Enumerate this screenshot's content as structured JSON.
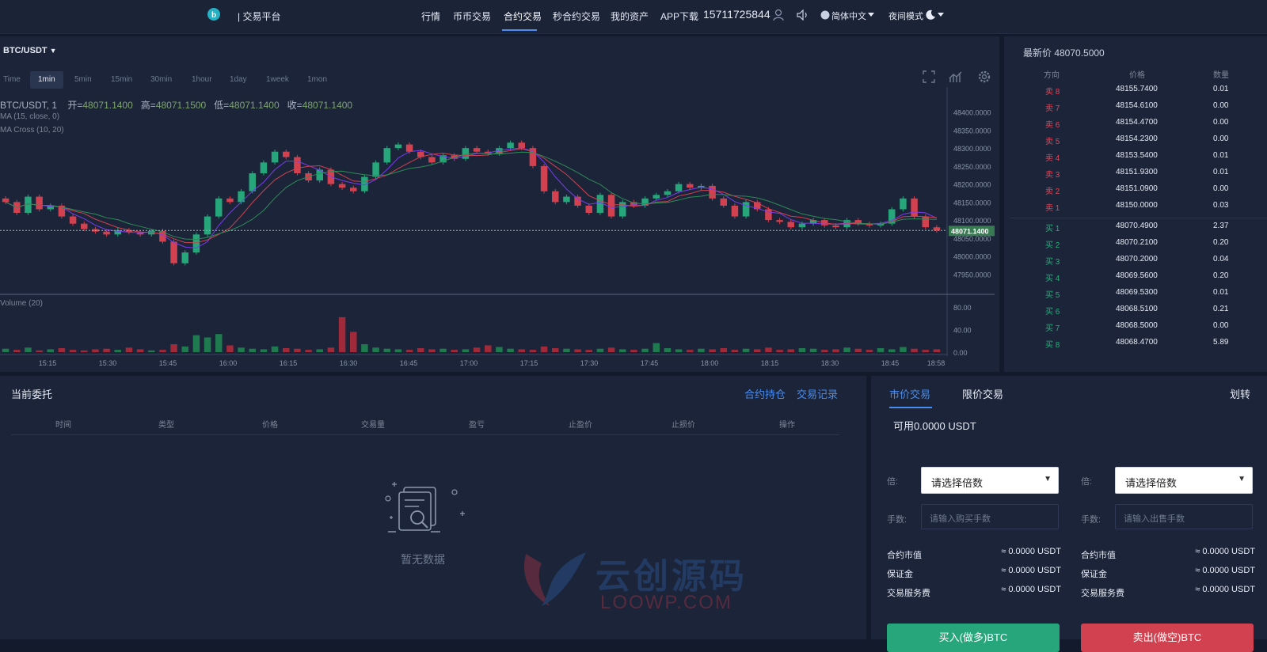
{
  "header": {
    "brand": "| 交易平台",
    "nav": [
      "行情",
      "币币交易",
      "合约交易",
      "秒合约交易",
      "我的资产",
      "APP下载"
    ],
    "active_nav": "合约交易",
    "phone": "15711725844",
    "language": "简体中文",
    "night_mode": "夜间模式"
  },
  "chart": {
    "pair": "BTC/USDT",
    "timeframes": [
      "Time",
      "1min",
      "5min",
      "15min",
      "30min",
      "1hour",
      "1day",
      "1week",
      "1mon"
    ],
    "active_timeframe": "1min",
    "symbol_line": "BTC/USDT, 1",
    "open_label": "开=",
    "open": "48071.1400",
    "high_label": "高=",
    "high": "48071.1500",
    "low_label": "低=",
    "low": "48071.1400",
    "close_label": "收=",
    "close": "48071.1400",
    "indicator_ma": "MA (15, close, 0)",
    "indicator_cross": "MA Cross (10, 20)",
    "indicator_volume": "Volume (20)",
    "last_price_label": "48071.1400"
  },
  "chart_data": {
    "type": "candlestick",
    "y_ticks": [
      "48400.0000",
      "48350.0000",
      "48300.0000",
      "48250.0000",
      "48200.0000",
      "48150.0000",
      "48100.0000",
      "48050.0000",
      "48000.0000",
      "47950.0000"
    ],
    "ylim": [
      47920,
      48430
    ],
    "x_ticks": [
      "15:15",
      "15:30",
      "15:45",
      "16:00",
      "16:15",
      "16:30",
      "16:45",
      "17:00",
      "17:15",
      "17:30",
      "17:45",
      "18:00",
      "18:15",
      "18:30",
      "18:45",
      "18:58"
    ],
    "volume_ticks": [
      "80.00",
      "40.00",
      "0.00"
    ],
    "volume_ylim": [
      0,
      80
    ],
    "close_path": [
      48150,
      48120,
      48165,
      48130,
      48140,
      48110,
      48090,
      48075,
      48068,
      48060,
      48072,
      48066,
      48060,
      48070,
      48040,
      47980,
      48010,
      48060,
      48110,
      48160,
      48150,
      48180,
      48230,
      48260,
      48290,
      48275,
      48230,
      48210,
      48240,
      48200,
      48190,
      48180,
      48220,
      48260,
      48300,
      48310,
      48290,
      48275,
      48260,
      48280,
      48270,
      48300,
      48290,
      48285,
      48300,
      48315,
      48300,
      48250,
      48180,
      48150,
      48165,
      48140,
      48120,
      48170,
      48110,
      48150,
      48140,
      48160,
      48170,
      48180,
      48200,
      48190,
      48195,
      48160,
      48140,
      48110,
      48150,
      48130,
      48100,
      48095,
      48080,
      48090,
      48100,
      48085,
      48080,
      48100,
      48090,
      48085,
      48090,
      48130,
      48160,
      48110,
      48080,
      48071
    ],
    "volumes": [
      6,
      4,
      8,
      3,
      5,
      7,
      4,
      3,
      5,
      6,
      4,
      8,
      5,
      3,
      4,
      14,
      10,
      30,
      26,
      32,
      12,
      8,
      6,
      5,
      10,
      7,
      6,
      4,
      5,
      8,
      62,
      36,
      14,
      8,
      6,
      5,
      4,
      7,
      5,
      6,
      4,
      5,
      8,
      12,
      9,
      6,
      5,
      4,
      10,
      7,
      6,
      5,
      4,
      6,
      8,
      5,
      4,
      6,
      16,
      7,
      5,
      4,
      6,
      5,
      7,
      4,
      6,
      5,
      8,
      4,
      5,
      7,
      6,
      4,
      5,
      8,
      6,
      4,
      7,
      5,
      9,
      6,
      4,
      5
    ]
  },
  "orderbook": {
    "title": "最新价 48070.5000",
    "headers": [
      "方向",
      "价格",
      "数量"
    ],
    "asks": [
      {
        "side": "卖 8",
        "price": "48155.7400",
        "qty": "0.01"
      },
      {
        "side": "卖 7",
        "price": "48154.6100",
        "qty": "0.00"
      },
      {
        "side": "卖 6",
        "price": "48154.4700",
        "qty": "0.00"
      },
      {
        "side": "卖 5",
        "price": "48154.2300",
        "qty": "0.00"
      },
      {
        "side": "卖 4",
        "price": "48153.5400",
        "qty": "0.01"
      },
      {
        "side": "卖 3",
        "price": "48151.9300",
        "qty": "0.01"
      },
      {
        "side": "卖 2",
        "price": "48151.0900",
        "qty": "0.00"
      },
      {
        "side": "卖 1",
        "price": "48150.0000",
        "qty": "0.03"
      }
    ],
    "bids": [
      {
        "side": "买 1",
        "price": "48070.4900",
        "qty": "2.37"
      },
      {
        "side": "买 2",
        "price": "48070.2100",
        "qty": "0.20"
      },
      {
        "side": "买 3",
        "price": "48070.2000",
        "qty": "0.04"
      },
      {
        "side": "买 4",
        "price": "48069.5600",
        "qty": "0.20"
      },
      {
        "side": "买 5",
        "price": "48069.5300",
        "qty": "0.01"
      },
      {
        "side": "买 6",
        "price": "48068.5100",
        "qty": "0.21"
      },
      {
        "side": "买 7",
        "price": "48068.5000",
        "qty": "0.00"
      },
      {
        "side": "买 8",
        "price": "48068.4700",
        "qty": "5.89"
      }
    ]
  },
  "orders": {
    "title": "当前委托",
    "links": [
      "合约持仓",
      "交易记录"
    ],
    "columns": [
      "时间",
      "类型",
      "价格",
      "交易量",
      "盈亏",
      "止盈价",
      "止损价",
      "操作"
    ],
    "empty": "暂无数据"
  },
  "trade": {
    "tabs": [
      "市价交易",
      "限价交易"
    ],
    "transfer": "划转",
    "available": "可用0.0000 USDT",
    "leverage_label": "倍:",
    "leverage_placeholder": "请选择倍数",
    "qty_label": "手数:",
    "buy_qty_placeholder": "请输入购买手数",
    "sell_qty_placeholder": "请输入出售手数",
    "contract_value_label": "合约市值",
    "margin_label": "保证金",
    "fee_label": "交易服务费",
    "zero_value": "≈ 0.0000 USDT",
    "buy_button": "买入(做多)BTC",
    "sell_button": "卖出(做空)BTC"
  },
  "watermark": {
    "cn": "云创源码",
    "en": "LOOWP.COM"
  },
  "colors": {
    "up": "#26a67a",
    "down": "#d2414f",
    "accent": "#4a8df0",
    "bg_panel": "#1b2438"
  }
}
